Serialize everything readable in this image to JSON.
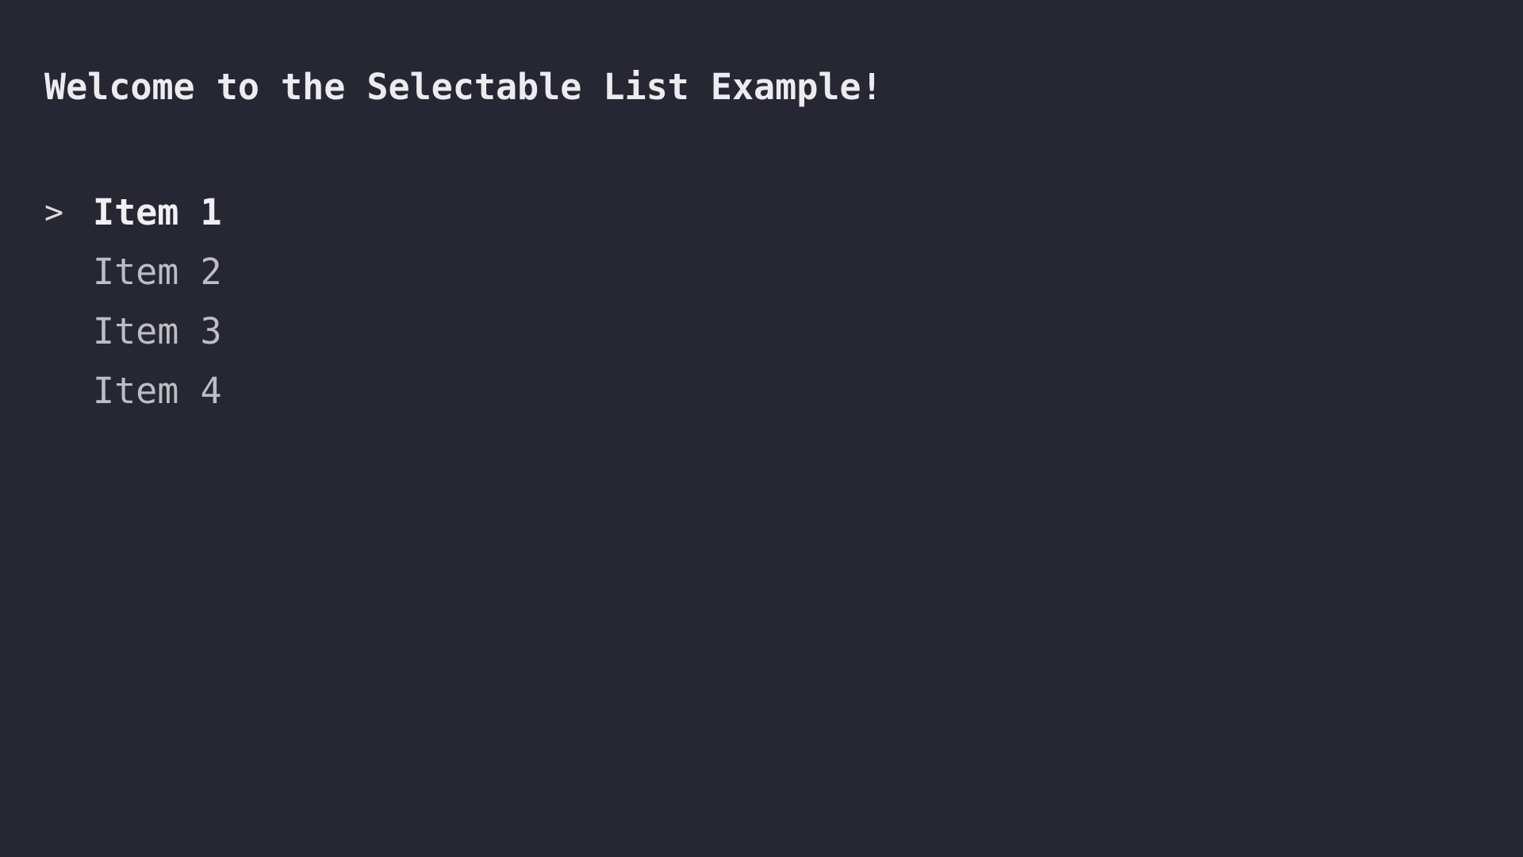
{
  "app": {
    "welcome_text": "Welcome to the Selectable List Example!",
    "cursor_glyph": ">"
  },
  "list": {
    "selected_index": 0,
    "items": [
      {
        "label": "Item 1"
      },
      {
        "label": "Item 2"
      },
      {
        "label": "Item 3"
      },
      {
        "label": "Item 4"
      }
    ]
  },
  "colors": {
    "background": "#272733",
    "heading": "#ececf0",
    "selected_text": "#f0f0f4",
    "normal_text": "#bdbdc4"
  }
}
